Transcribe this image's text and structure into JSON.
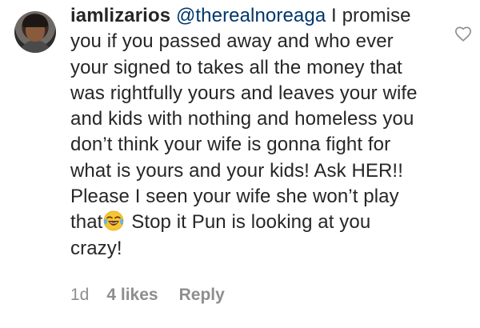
{
  "comment": {
    "username": "iamlizarios",
    "mention": "@therealnoreaga",
    "text_part1": " I promise you if you passed away and who ever your signed to takes all the money that was rightfully yours and leaves your wife and kids with nothing and  homeless you don’t think your wife is gonna fight for what is yours and your kids! Ask HER!! Please I seen your wife she won’t play that",
    "emoji": "face-with-tears-of-joy",
    "text_part2": " Stop it Pun is looking at you crazy!",
    "time": "1d",
    "likes": "4 likes",
    "reply_label": "Reply",
    "like_icon": "heart-outline-icon"
  },
  "colors": {
    "text": "#262626",
    "mention": "#00376b",
    "meta": "#8e8e8e",
    "background": "#ffffff"
  }
}
